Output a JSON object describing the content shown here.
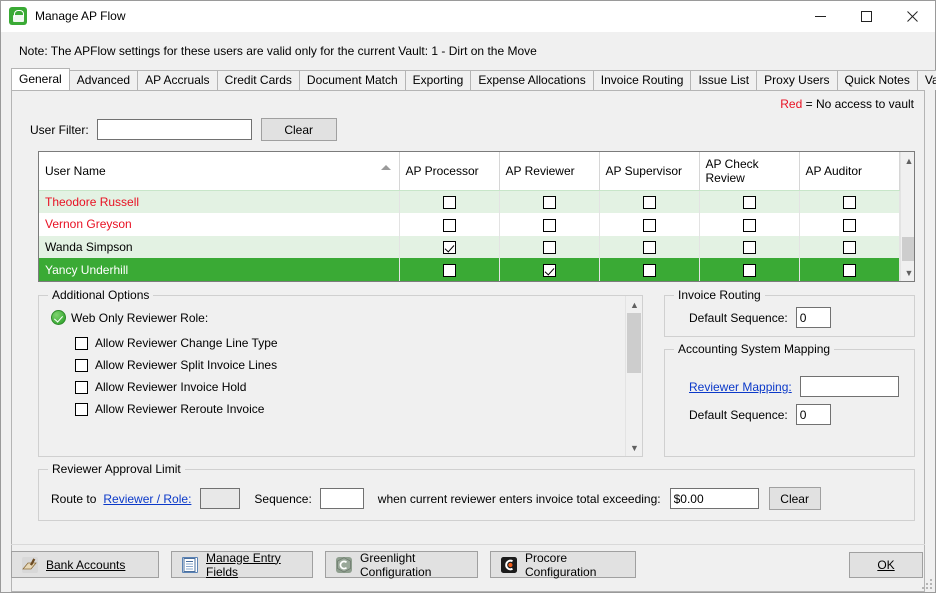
{
  "window": {
    "title": "Manage AP Flow",
    "icon": "app-lock-icon",
    "minimize": "minimize-icon",
    "maximize": "maximize-icon",
    "close": "close-icon"
  },
  "note": "Note:  The APFlow settings for these users are valid only for the current Vault: 1 - Dirt on the Move",
  "tabs": [
    {
      "label": "General",
      "active": true
    },
    {
      "label": "Advanced",
      "active": false
    },
    {
      "label": "AP Accruals",
      "active": false
    },
    {
      "label": "Credit Cards",
      "active": false
    },
    {
      "label": "Document Match",
      "active": false
    },
    {
      "label": "Exporting",
      "active": false
    },
    {
      "label": "Expense Allocations",
      "active": false
    },
    {
      "label": "Invoice Routing",
      "active": false
    },
    {
      "label": "Issue List",
      "active": false
    },
    {
      "label": "Proxy Users",
      "active": false
    },
    {
      "label": "Quick Notes",
      "active": false
    },
    {
      "label": "Validation",
      "active": false
    }
  ],
  "legend": {
    "red_word": "Red",
    "text": "= No access to vault",
    "red_color": "#e81123"
  },
  "filter": {
    "label": "User Filter:",
    "value": "",
    "placeholder": "",
    "clear_label": "Clear"
  },
  "grid": {
    "columns": [
      "User Name",
      "AP Processor",
      "AP Reviewer",
      "AP Supervisor",
      "AP Check Review",
      "AP Auditor"
    ],
    "sort_column": "User Name",
    "sort_direction": "ascending",
    "rows": [
      {
        "name": "Theodore Russell",
        "no_access": true,
        "selected": false,
        "processor": false,
        "reviewer": false,
        "supervisor": false,
        "check_review": false,
        "auditor": false
      },
      {
        "name": "Vernon Greyson",
        "no_access": true,
        "selected": false,
        "processor": false,
        "reviewer": false,
        "supervisor": false,
        "check_review": false,
        "auditor": false
      },
      {
        "name": "Wanda Simpson",
        "no_access": false,
        "selected": false,
        "processor": true,
        "reviewer": false,
        "supervisor": false,
        "check_review": false,
        "auditor": false
      },
      {
        "name": "Yancy Underhill",
        "no_access": false,
        "selected": true,
        "processor": false,
        "reviewer": true,
        "supervisor": false,
        "check_review": false,
        "auditor": false
      }
    ]
  },
  "additional_options": {
    "title": "Additional Options",
    "role_label": "Web Only Reviewer Role:",
    "role_status_icon": "green-check-icon",
    "options": [
      {
        "label": "Allow Reviewer Change Line Type",
        "checked": false
      },
      {
        "label": "Allow Reviewer Split Invoice Lines",
        "checked": false
      },
      {
        "label": "Allow Reviewer Invoice Hold",
        "checked": false
      },
      {
        "label": "Allow Reviewer Reroute Invoice",
        "checked": false
      }
    ]
  },
  "invoice_routing": {
    "title": "Invoice Routing",
    "default_sequence_label": "Default Sequence:",
    "default_sequence_value": "0"
  },
  "accounting_mapping": {
    "title": "Accounting System Mapping",
    "reviewer_mapping_label": "Reviewer Mapping:",
    "reviewer_mapping_value": "",
    "default_sequence_label": "Default Sequence:",
    "default_sequence_value": "0"
  },
  "reviewer_limit": {
    "title": "Reviewer Approval Limit",
    "route_to_label": "Route to",
    "reviewer_role_link": "Reviewer / Role:",
    "reviewer_role_value": "",
    "sequence_label": "Sequence:",
    "sequence_value": "",
    "middle_text": "when current reviewer enters invoice total exceeding:",
    "amount_value": "$0.00",
    "clear_label": "Clear"
  },
  "footer": {
    "buttons": [
      {
        "label": "Bank Accounts",
        "icon": "bank-accounts-icon",
        "accel": "B"
      },
      {
        "label": "Manage Entry Fields",
        "icon": "entry-fields-icon",
        "accel": "M"
      },
      {
        "label": "Greenlight Configuration",
        "icon": "greenlight-icon",
        "accel": ""
      },
      {
        "label": "Procore Configuration",
        "icon": "procore-icon",
        "accel": ""
      }
    ],
    "ok_label": "OK"
  },
  "colors": {
    "accent_green": "#3aaa35",
    "row_alt_green": "#e3f2e3",
    "selection_green": "#3aaa35",
    "link_blue": "#0b39c9",
    "alert_red": "#e81123"
  }
}
